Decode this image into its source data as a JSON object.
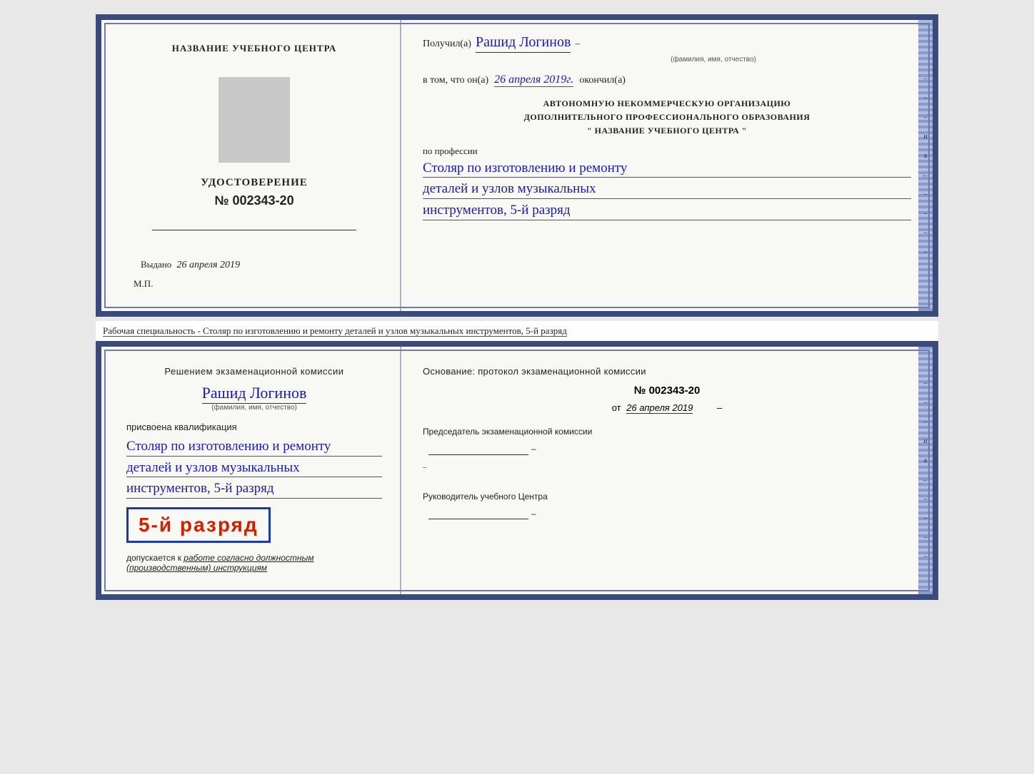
{
  "upper_card": {
    "left": {
      "institution_name": "НАЗВАНИЕ УЧЕБНОГО ЦЕНТРА",
      "cert_title": "УДОСТОВЕРЕНИЕ",
      "cert_number_prefix": "№",
      "cert_number": "002343-20",
      "issued_label": "Выдано",
      "issued_date": "26 апреля 2019",
      "mp_label": "М.П."
    },
    "right": {
      "received_label": "Получил(а)",
      "recipient_name": "Рашид Логинов",
      "fio_sub": "(фамилия, имя, отчество)",
      "в_том_label": "в том, что он(а)",
      "completion_date": "26 апреля 2019г.",
      "completed_label": "окончил(а)",
      "institution_block_line1": "АВТОНОМНУЮ НЕКОММЕРЧЕСКУЮ ОРГАНИЗАЦИЮ",
      "institution_block_line2": "ДОПОЛНИТЕЛЬНОГО ПРОФЕССИОНАЛЬНОГО ОБРАЗОВАНИЯ",
      "institution_block_line3": "\"   НАЗВАНИЕ УЧЕБНОГО ЦЕНТРА   \"",
      "profession_label": "по профессии",
      "profession_line1": "Столяр по изготовлению и ремонту",
      "profession_line2": "деталей и узлов музыкальных",
      "profession_line3": "инструментов, 5-й разряд"
    }
  },
  "specialty_banner": {
    "label": "Рабочая специальность - Столяр по изготовлению и ремонту деталей и узлов музыкальных инструментов, 5-й разряд"
  },
  "lower_card": {
    "left": {
      "commission_heading": "Решением экзаменационной комиссии",
      "recipient_name": "Рашид Логинов",
      "fio_sub": "(фамилия, имя, отчество)",
      "qualification_label": "присвоена квалификация",
      "qualification_line1": "Столяр по изготовлению и ремонту",
      "qualification_line2": "деталей и узлов музыкальных",
      "qualification_line3": "инструментов, 5-й разряд",
      "rank_badge_text": "5-й разряд",
      "допускается_label": "допускается к",
      "допускается_value": "работе согласно должностным (производственным) инструкциям"
    },
    "right": {
      "basis_label": "Основание: протокол экзаменационной комиссии",
      "protocol_number": "№  002343-20",
      "от_label": "от",
      "от_date": "26 апреля 2019",
      "chairman_label": "Председатель экзаменационной комиссии",
      "director_label": "Руководитель учебного Центра"
    }
  },
  "right_strip_chars": [
    "–",
    "–",
    "–",
    "и",
    "а",
    "←",
    "–",
    "–",
    "–",
    "–"
  ]
}
